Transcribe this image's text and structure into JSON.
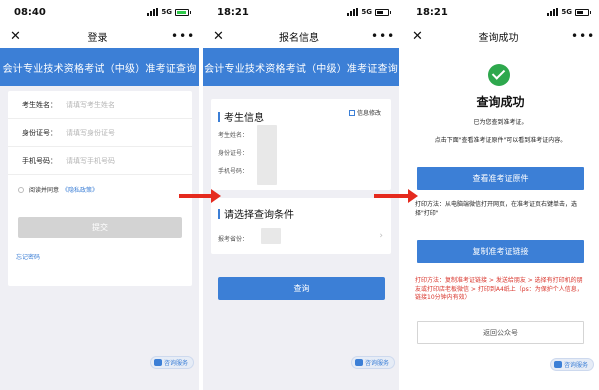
{
  "panel1": {
    "time": "08:40",
    "network": "5G",
    "nav_title": "登录",
    "banner": "会计专业技术资格考试（中级）准考证查询",
    "fields": [
      {
        "label": "考生姓名：",
        "placeholder": "请填写考生姓名"
      },
      {
        "label": "身份证号：",
        "placeholder": "请填写身份证号"
      },
      {
        "label": "手机号码：",
        "placeholder": "请填写手机号码"
      }
    ],
    "agree_text": "阅读并同意",
    "privacy_link": "《隐私政策》",
    "submit_label": "提交",
    "forgot_label": "忘记密码",
    "consult_label": "咨询服务"
  },
  "panel2": {
    "time": "18:21",
    "network": "5G",
    "nav_title": "报名信息",
    "banner": "会计专业技术资格考试（中级）准考证查询",
    "section1_title": "考生信息",
    "edit_label": "信息修改",
    "info_labels": [
      "考生姓名：",
      "身份证号：",
      "手机号码："
    ],
    "section2_title": "请选择查询条件",
    "province_label": "报考省份：",
    "query_label": "查询",
    "consult_label": "咨询服务"
  },
  "panel3": {
    "time": "18:21",
    "network": "5G",
    "nav_title": "查询成功",
    "success_title": "查询成功",
    "line1": "已为您查到准考证。",
    "line2": "点击下面\"查看准考证原件\"可以看到准考证内容。",
    "view_button": "查看准考证原件",
    "print_note": "打印方法：从电脑端微信打开网页，在准考证页右键单击，选择\"打印\"",
    "copy_button": "复制准考证链接",
    "red_note": "打印方法：复制准考证链接 > 发送给朋友 > 选择有打印机的朋友或打印店老板微信 > 打印到A4纸上（ps：为保护个人信息，链接10分钟内有效）",
    "back_button": "返回公众号",
    "consult_label": "咨询服务"
  },
  "colors": {
    "brand_blue": "#3c7fd6",
    "arrow_red": "#e52a1e",
    "success_green": "#2ea84d",
    "note_red": "#d9352c"
  },
  "icons": [
    "close-icon",
    "more-icon",
    "signal-icon",
    "battery-icon",
    "edit-icon",
    "check-circle-icon",
    "chevron-right-icon",
    "chat-icon",
    "arrow-right-icon"
  ]
}
